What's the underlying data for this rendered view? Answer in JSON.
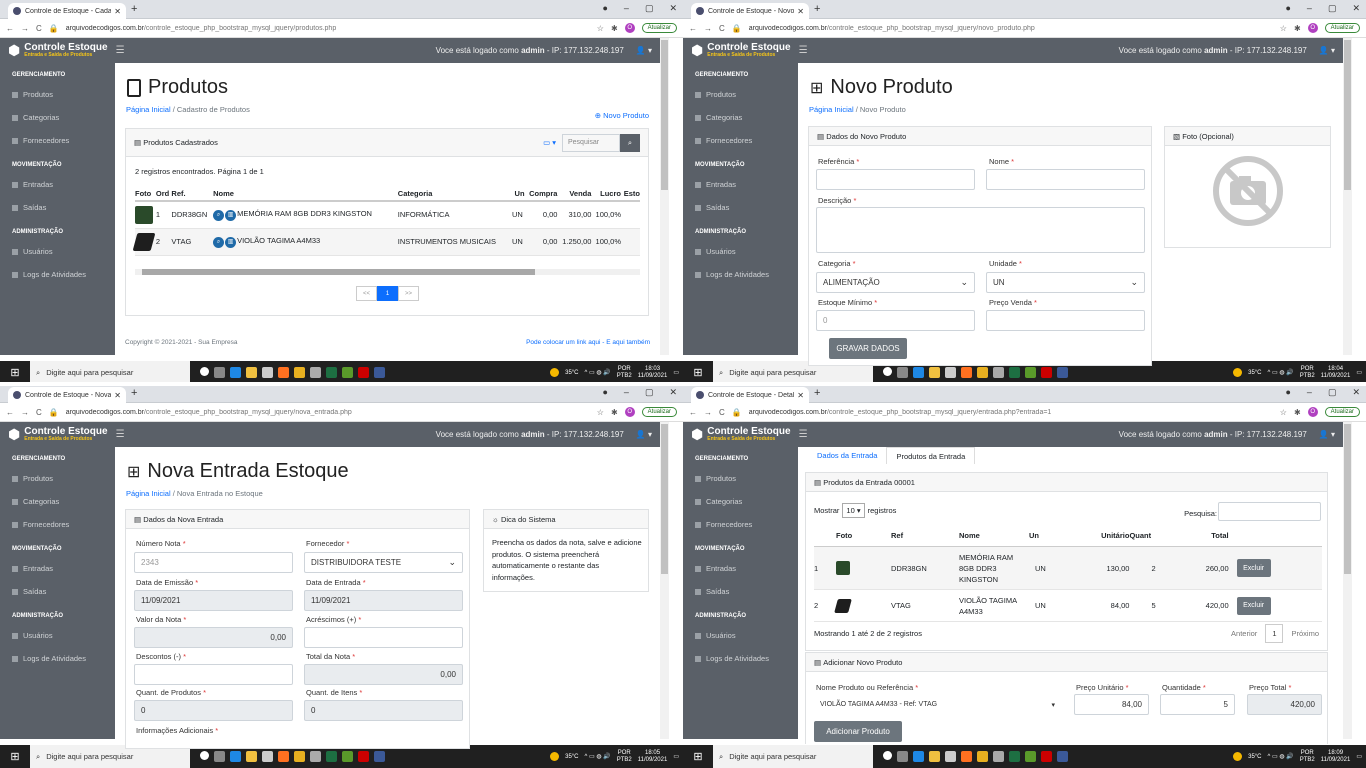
{
  "taskbar": {
    "search": "Digite aqui para pesquisar",
    "temp": "35°C",
    "lang": "POR",
    "lang2": "PTB2",
    "date": "11/09/2021"
  },
  "header": {
    "brand": "Controle Estoque",
    "brand_sub": "Entrada e Saída de Produtos",
    "logged_prefix": "Voce está logado como ",
    "user": "admin",
    "ip": " - IP: 177.132.248.197"
  },
  "sidebar": {
    "groups": [
      {
        "heading": "GERENCIAMENTO",
        "items": [
          "Produtos",
          "Categorias",
          "Fornecedores"
        ]
      },
      {
        "heading": "MOVIMENTAÇÃO",
        "items": [
          "Entradas",
          "Saídas"
        ]
      },
      {
        "heading": "ADMINISTRAÇÃO",
        "items": [
          "Usuários",
          "Logs de Atividades"
        ]
      }
    ]
  },
  "browser": {
    "update_label": "Atualizar"
  },
  "win1": {
    "tab_title": "Controle de Estoque - Cadastro d",
    "url_host": "arquivodecodigos.com.br",
    "url_path": "/controle_estoque_php_bootstrap_mysql_jquery/produtos.php",
    "time": "18:03",
    "title": "Produtos",
    "crumb_home": "Página Inicial",
    "crumb_current": "Cadastro de Produtos",
    "new_link": "Novo Produto",
    "card_title": "Produtos Cadastrados",
    "search_placeholder": "Pesquisar",
    "info": "2 registros encontrados. Página 1 de 1",
    "columns": [
      "Foto",
      "Ord",
      "Ref.",
      "Nome",
      "Categoria",
      "Un",
      "Compra",
      "Venda",
      "Lucro",
      "Esto"
    ],
    "rows": [
      {
        "ord": "1",
        "ref": "DDR38GN",
        "nome": "MEMÓRIA RAM 8GB DDR3 KINGSTON",
        "cat": "INFORMÁTICA",
        "un": "UN",
        "compra": "0,00",
        "venda": "310,00",
        "lucro": "100,0%"
      },
      {
        "ord": "2",
        "ref": "VTAG",
        "nome": "VIOLÃO TAGIMA A4M33",
        "cat": "INSTRUMENTOS MUSICAIS",
        "un": "UN",
        "compra": "0,00",
        "venda": "1.250,00",
        "lucro": "100,0%"
      }
    ],
    "pager": [
      "<<",
      "1",
      ">>"
    ],
    "footer_left": "Copyright © 2021-2021 - Sua Empresa",
    "footer_right": "Pode colocar um link aqui - E aqui também"
  },
  "win2": {
    "tab_title": "Controle de Estoque - Novo Prod",
    "url_host": "arquivodecodigos.com.br",
    "url_path": "/controle_estoque_php_bootstrap_mysql_jquery/novo_produto.php",
    "time": "18:04",
    "title": "Novo Produto",
    "crumb_home": "Página Inicial",
    "crumb_current": "Novo Produto",
    "card_title": "Dados do Novo Produto",
    "photo_title": "Foto (Opcional)",
    "lbl_ref": "Referência",
    "lbl_nome": "Nome",
    "lbl_desc": "Descrição",
    "lbl_cat": "Categoria",
    "lbl_un": "Unidade",
    "lbl_min": "Estoque Mínimo",
    "lbl_preco": "Preço Venda",
    "cat_value": "ALIMENTAÇÃO",
    "un_value": "UN",
    "min_placeholder": "0",
    "save_button": "GRAVAR DADOS"
  },
  "win3": {
    "tab_title": "Controle de Estoque - Nova Entr",
    "url_host": "arquivodecodigos.com.br",
    "url_path": "/controle_estoque_php_bootstrap_mysql_jquery/nova_entrada.php",
    "time": "18:05",
    "title": "Nova Entrada Estoque",
    "crumb_home": "Página Inicial",
    "crumb_current": "Nova Entrada no Estoque",
    "card_title": "Dados da Nova Entrada",
    "tip_title": "Dica do Sistema",
    "tip_text": "Preencha os dados da nota, salve e adicione produtos. O sistema preencherá automaticamente o restante das informações.",
    "lbl_num": "Número Nota",
    "lbl_forn": "Fornecedor",
    "lbl_emis": "Data de Emissão",
    "lbl_ent": "Data de Entrada",
    "lbl_valor": "Valor da Nota",
    "lbl_acres": "Acréscimos (+)",
    "lbl_desc": "Descontos (-)",
    "lbl_total": "Total da Nota",
    "lbl_qprod": "Quant. de Produtos",
    "lbl_qitens": "Quant. de Itens",
    "lbl_info": "Informações Adicionais",
    "num_placeholder": "2343",
    "forn_value": "DISTRIBUIDORA TESTE",
    "emis_value": "11/09/2021",
    "ent_value": "11/09/2021",
    "valor_value": "0,00",
    "total_value": "0,00",
    "qprod_value": "0",
    "qitens_value": "0"
  },
  "win4": {
    "tab_title": "Controle de Estoque - Detalhes d",
    "url_host": "arquivodecodigos.com.br",
    "url_path": "/controle_estoque_php_bootstrap_mysql_jquery/entrada.php?entrada=1",
    "time": "18:09",
    "tab_dados": "Dados da Entrada",
    "tab_prod": "Produtos da Entrada",
    "card_title": "Produtos da Entrada 00001",
    "show_pre": "Mostrar",
    "show_value": "10",
    "show_post": "registros",
    "search_label": "Pesquisa:",
    "columns": [
      "",
      "Foto",
      "Ref",
      "Nome",
      "Un",
      "Unitário",
      "Quant",
      "Total",
      ""
    ],
    "rows": [
      {
        "n": "1",
        "ref": "DDR38GN",
        "nome": "MEMÓRIA RAM 8GB DDR3 KINGSTON",
        "un": "UN",
        "unit": "130,00",
        "quant": "2",
        "total": "260,00",
        "btn": "Excluir"
      },
      {
        "n": "2",
        "ref": "VTAG",
        "nome": "VIOLÃO TAGIMA A4M33",
        "un": "UN",
        "unit": "84,00",
        "quant": "5",
        "total": "420,00",
        "btn": "Excluir"
      }
    ],
    "showing": "Mostrando 1 até 2 de 2 registros",
    "prev": "Anterior",
    "page": "1",
    "next": "Próximo",
    "add_title": "Adicionar Novo Produto",
    "lbl_prod": "Nome Produto ou Referência",
    "lbl_unit": "Preço Unitário",
    "lbl_qtd": "Quantidade",
    "lbl_ptotal": "Preço Total",
    "prod_value": "VIOLÃO TAGIMA A4M33 - Ref: VTAG",
    "unit_value": "84,00",
    "qtd_value": "5",
    "ptotal_value": "420,00",
    "add_button": "Adicionar Produto"
  }
}
